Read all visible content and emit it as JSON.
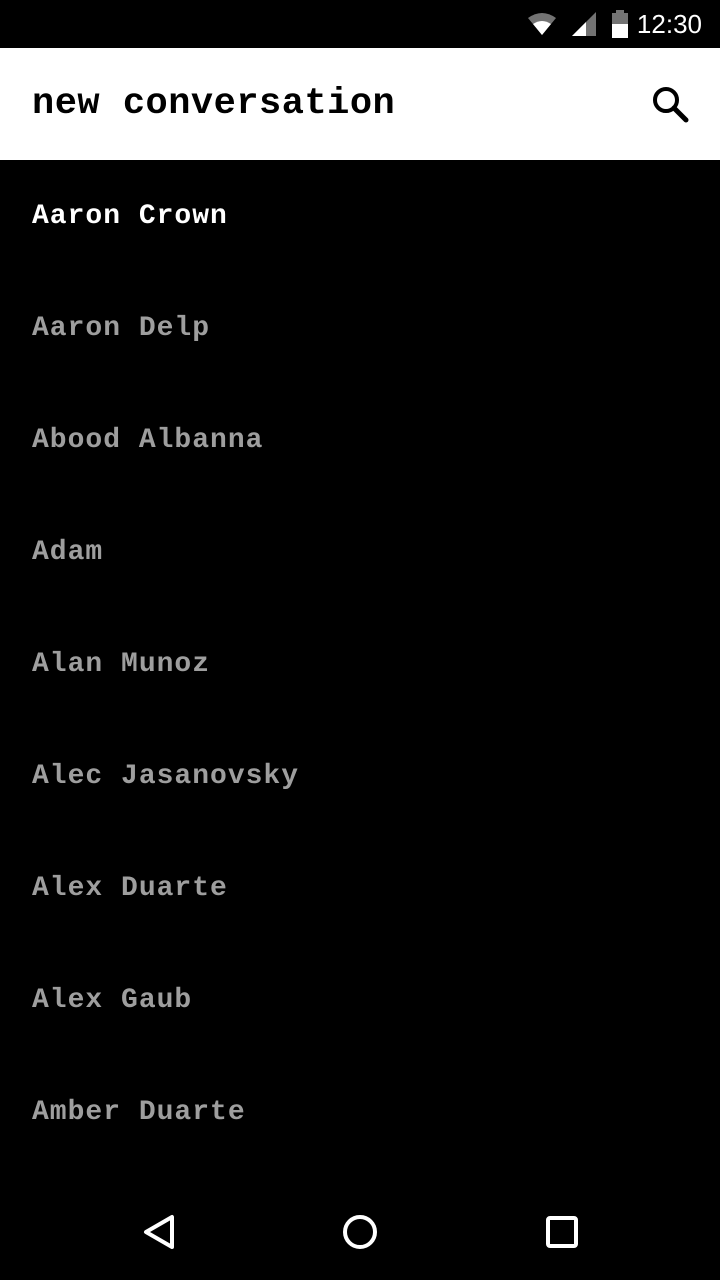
{
  "status_bar": {
    "time": "12:30",
    "icons": [
      "wifi-icon",
      "cellular-signal-icon",
      "battery-icon"
    ]
  },
  "app_bar": {
    "title": "new conversation",
    "search_icon": "search-icon"
  },
  "contacts": [
    {
      "name": "Aaron Crown"
    },
    {
      "name": "Aaron Delp"
    },
    {
      "name": "Abood Albanna"
    },
    {
      "name": "Adam"
    },
    {
      "name": "Alan Munoz"
    },
    {
      "name": "Alec Jasanovsky"
    },
    {
      "name": "Alex Duarte"
    },
    {
      "name": "Alex Gaub"
    },
    {
      "name": "Amber Duarte"
    }
  ],
  "nav_bar": {
    "buttons": [
      "back-icon",
      "home-icon",
      "recents-icon"
    ]
  },
  "colors": {
    "background": "#000000",
    "app_bar": "#ffffff",
    "primary_text": "#ffffff",
    "secondary_text": "#9e9e9e"
  }
}
